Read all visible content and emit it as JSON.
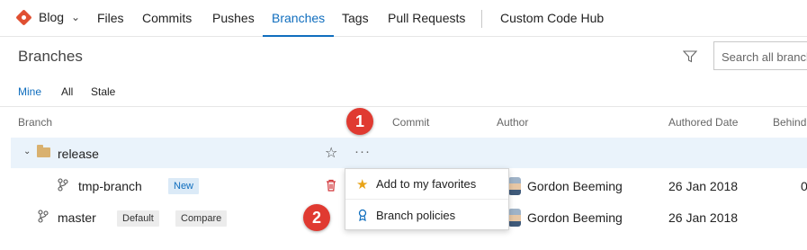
{
  "topnav": {
    "repo_name": "Blog",
    "tabs": [
      "Files",
      "Commits",
      "Pushes",
      "Branches",
      "Tags",
      "Pull Requests",
      "Custom Code Hub"
    ],
    "active_tab": "Branches"
  },
  "header": {
    "title": "Branches",
    "search_placeholder": "Search all branch"
  },
  "subtabs": [
    "Mine",
    "All",
    "Stale"
  ],
  "columns": [
    "Branch",
    "Commit",
    "Author",
    "Authored Date",
    "Behind"
  ],
  "rows": [
    {
      "name": "release",
      "type": "folder"
    },
    {
      "name": "tmp-branch",
      "badge": "New",
      "author": "Gordon Beeming",
      "date": "26 Jan 2018",
      "behind": "0"
    },
    {
      "name": "master",
      "badges": [
        "Default",
        "Compare"
      ],
      "author": "Gordon Beeming",
      "date": "26 Jan 2018"
    }
  ],
  "context_menu": {
    "items": [
      "Add to my favorites",
      "Branch policies"
    ]
  },
  "callouts": [
    "1",
    "2"
  ],
  "colors": {
    "accent": "#106ebe",
    "callout": "#e03a31",
    "highlight_row": "#eaf3fb"
  }
}
